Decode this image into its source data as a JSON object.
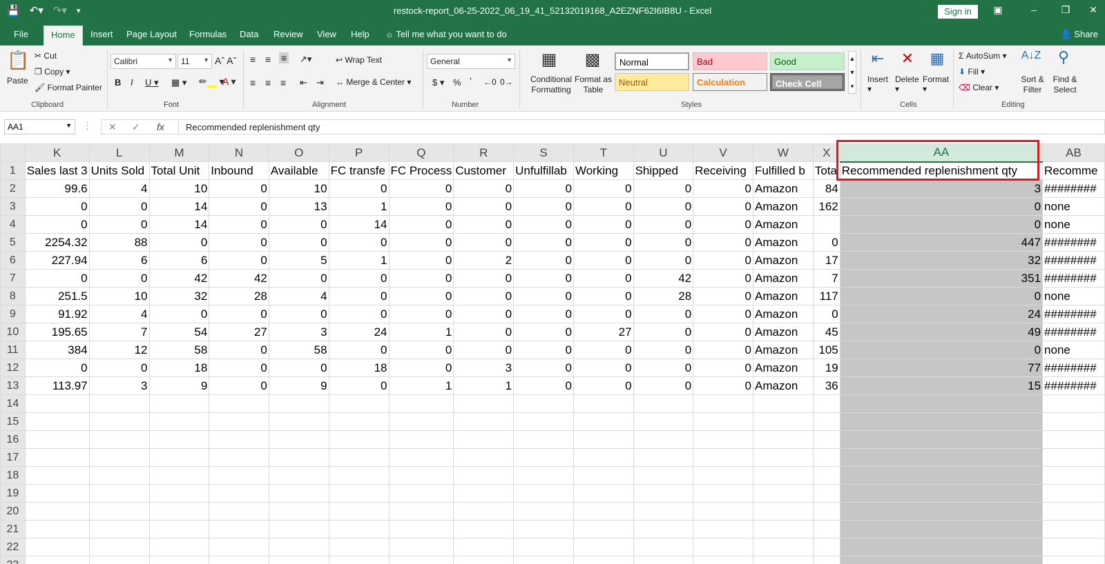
{
  "titlebar": {
    "title": "restock-report_06-25-2022_06_19_41_52132019168_A2EZNF62I6IB8U  -  Excel",
    "signin": "Sign in"
  },
  "tabs": [
    "File",
    "Home",
    "Insert",
    "Page Layout",
    "Formulas",
    "Data",
    "Review",
    "View",
    "Help"
  ],
  "tellme": "Tell me what you want to do",
  "share": "Share",
  "ribbon": {
    "clipboard": {
      "paste": "Paste",
      "cut": "Cut",
      "copy": "Copy",
      "format_painter": "Format Painter",
      "label": "Clipboard"
    },
    "font": {
      "name": "Calibri",
      "size": "11",
      "label": "Font"
    },
    "alignment": {
      "wrap": "Wrap Text",
      "merge": "Merge & Center",
      "label": "Alignment"
    },
    "number": {
      "format": "General",
      "label": "Number"
    },
    "styles": {
      "conditional": "Conditional Formatting",
      "format_table": "Format as Table",
      "normal": "Normal",
      "bad": "Bad",
      "good": "Good",
      "neutral": "Neutral",
      "calculation": "Calculation",
      "check": "Check Cell",
      "label": "Styles"
    },
    "cells": {
      "insert": "Insert",
      "delete": "Delete",
      "format": "Format",
      "label": "Cells"
    },
    "editing": {
      "autosum": "AutoSum",
      "fill": "Fill",
      "clear": "Clear",
      "sort": "Sort & Filter",
      "find": "Find & Select",
      "label": "Editing"
    }
  },
  "formula_bar": {
    "namebox": "AA1",
    "content": "Recommended replenishment qty"
  },
  "columns": [
    "K",
    "L",
    "M",
    "N",
    "O",
    "P",
    "Q",
    "R",
    "S",
    "T",
    "U",
    "V",
    "W",
    "X",
    "AA",
    "AB"
  ],
  "header_row": [
    "Sales last 3",
    "Units Sold",
    "Total Unit",
    "Inbound",
    "Available",
    "FC transfe",
    "FC Process",
    "Customer",
    "Unfulfillab",
    "Working",
    "Shipped",
    "Receiving",
    "Fulfilled b",
    "Tota",
    "Recommended replenishment qty",
    "Recomme"
  ],
  "rows": [
    [
      "99.6",
      "4",
      "10",
      "0",
      "10",
      "0",
      "0",
      "0",
      "0",
      "0",
      "0",
      "0",
      "Amazon",
      "84",
      "3",
      "########"
    ],
    [
      "0",
      "0",
      "14",
      "0",
      "13",
      "1",
      "0",
      "0",
      "0",
      "0",
      "0",
      "0",
      "Amazon",
      "162",
      "0",
      "none"
    ],
    [
      "0",
      "0",
      "14",
      "0",
      "0",
      "14",
      "0",
      "0",
      "0",
      "0",
      "0",
      "0",
      "Amazon",
      "",
      "0",
      "none"
    ],
    [
      "2254.32",
      "88",
      "0",
      "0",
      "0",
      "0",
      "0",
      "0",
      "0",
      "0",
      "0",
      "0",
      "Amazon",
      "0",
      "447",
      "########"
    ],
    [
      "227.94",
      "6",
      "6",
      "0",
      "5",
      "1",
      "0",
      "2",
      "0",
      "0",
      "0",
      "0",
      "Amazon",
      "17",
      "32",
      "########"
    ],
    [
      "0",
      "0",
      "42",
      "42",
      "0",
      "0",
      "0",
      "0",
      "0",
      "0",
      "42",
      "0",
      "Amazon",
      "7",
      "351",
      "########"
    ],
    [
      "251.5",
      "10",
      "32",
      "28",
      "4",
      "0",
      "0",
      "0",
      "0",
      "0",
      "28",
      "0",
      "Amazon",
      "117",
      "0",
      "none"
    ],
    [
      "91.92",
      "4",
      "0",
      "0",
      "0",
      "0",
      "0",
      "0",
      "0",
      "0",
      "0",
      "0",
      "Amazon",
      "0",
      "24",
      "########"
    ],
    [
      "195.65",
      "7",
      "54",
      "27",
      "3",
      "24",
      "1",
      "0",
      "0",
      "27",
      "0",
      "0",
      "Amazon",
      "45",
      "49",
      "########"
    ],
    [
      "384",
      "12",
      "58",
      "0",
      "58",
      "0",
      "0",
      "0",
      "0",
      "0",
      "0",
      "0",
      "Amazon",
      "105",
      "0",
      "none"
    ],
    [
      "0",
      "0",
      "18",
      "0",
      "0",
      "18",
      "0",
      "3",
      "0",
      "0",
      "0",
      "0",
      "Amazon",
      "19",
      "77",
      "########"
    ],
    [
      "113.97",
      "3",
      "9",
      "0",
      "9",
      "0",
      "1",
      "1",
      "0",
      "0",
      "0",
      "0",
      "Amazon",
      "36",
      "15",
      "########"
    ]
  ],
  "empty_row_numbers": [
    "14",
    "15",
    "16",
    "17",
    "18",
    "19",
    "20",
    "21",
    "22",
    "23"
  ]
}
